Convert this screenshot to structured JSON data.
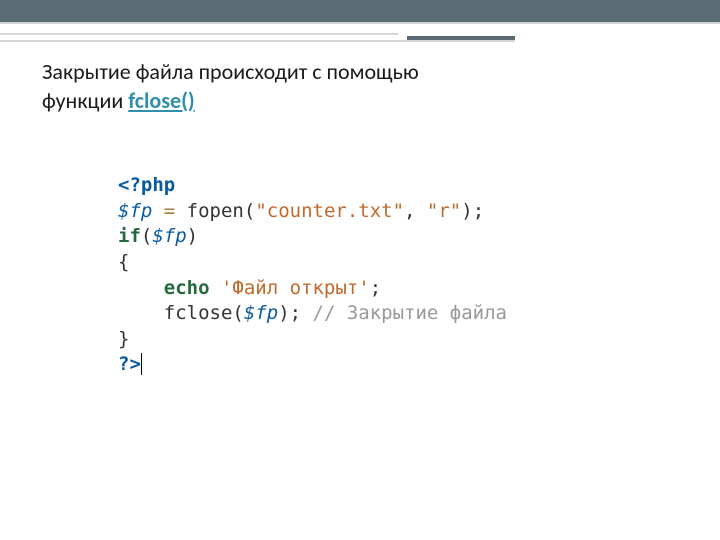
{
  "heading": {
    "line1": "Закрытие файла происходит с помощью",
    "line2_prefix": "функции ",
    "link_text": "fclose()"
  },
  "code": {
    "php_open": "<?php",
    "var_fp": "$fp",
    "assign": " = ",
    "fopen": "fopen",
    "lp": "(",
    "str_file": "\"counter.txt\"",
    "comma": ", ",
    "str_mode": "\"r\"",
    "rp_semi": ");",
    "kw_if": "if",
    "lp2": "(",
    "var_fp2": "$fp",
    "rp2": ")",
    "brace_open": "{",
    "indent": "    ",
    "echo": "echo",
    "space": " ",
    "str_opened": "'Файл открыт'",
    "semi": ";",
    "fclose": "fclose",
    "lp3": "(",
    "var_fp3": "$fp",
    "rp_semi2": ");",
    "comment": " // Закрытие файла",
    "brace_close": "}",
    "php_close": "?>"
  }
}
